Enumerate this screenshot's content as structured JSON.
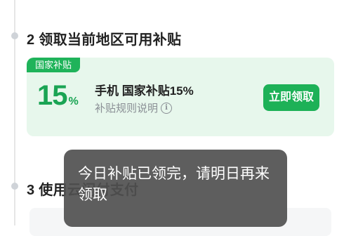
{
  "step2": {
    "title": "2 领取当前地区可用补贴"
  },
  "subsidy_card": {
    "badge": "国家补贴",
    "percent_value": "15",
    "percent_symbol": "%",
    "product_label": "手机 国家补贴15%",
    "rules_link": "补贴规则说明",
    "claim_button": "立即领取",
    "icons": {
      "rules_info": "info-icon"
    },
    "colors": {
      "accent": "#1db157",
      "card_bg": "#e7f7ec"
    }
  },
  "step3": {
    "title": "3 使用云闪付支付"
  },
  "toast": {
    "message": "今日补贴已领完，请明日再来领取"
  }
}
